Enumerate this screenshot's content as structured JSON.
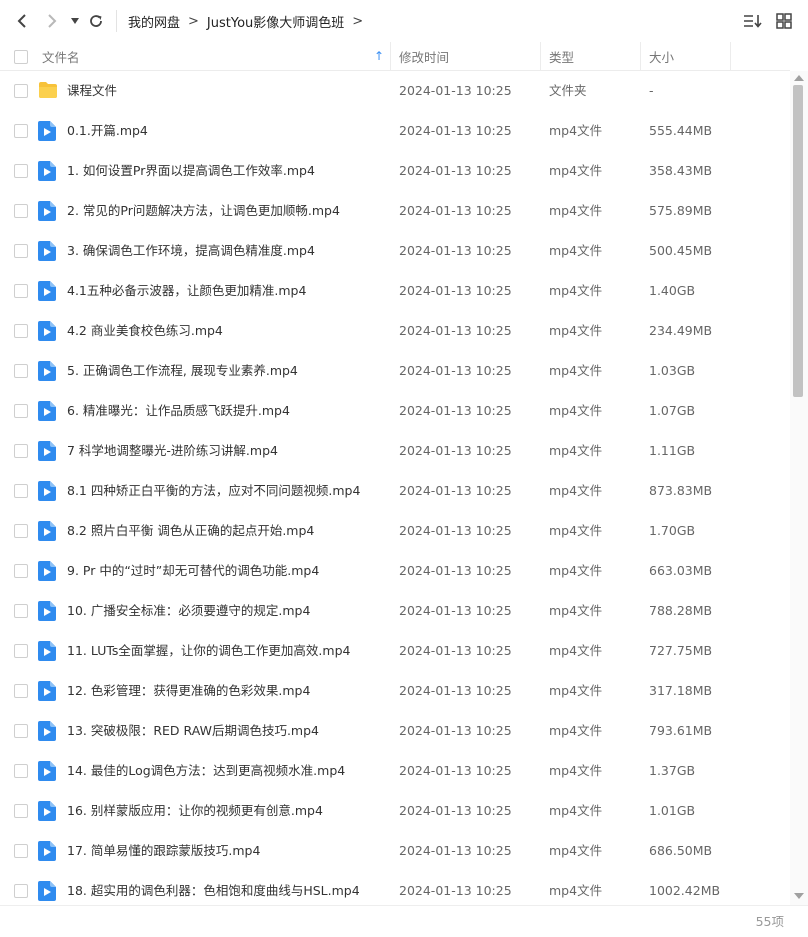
{
  "breadcrumb": [
    "我的网盘",
    "JustYou影像大师调色班"
  ],
  "columns": {
    "name": "文件名",
    "time": "修改时间",
    "type": "类型",
    "size": "大小"
  },
  "colors": {
    "accent": "#3b8ff3",
    "folder": "#f7c23a",
    "video": "#2f8bef"
  },
  "rows": [
    {
      "icon": "folder-icon",
      "name": "课程文件",
      "time": "2024-01-13 10:25",
      "type": "文件夹",
      "size": "-"
    },
    {
      "icon": "video-file-icon",
      "name": "0.1.开篇.mp4",
      "time": "2024-01-13 10:25",
      "type": "mp4文件",
      "size": "555.44MB"
    },
    {
      "icon": "video-file-icon",
      "name": "1. 如何设置Pr界面以提高调色工作效率.mp4",
      "time": "2024-01-13 10:25",
      "type": "mp4文件",
      "size": "358.43MB"
    },
    {
      "icon": "video-file-icon",
      "name": "2. 常见的Pr问题解决方法，让调色更加顺畅.mp4",
      "time": "2024-01-13 10:25",
      "type": "mp4文件",
      "size": "575.89MB"
    },
    {
      "icon": "video-file-icon",
      "name": "3. 确保调色工作环境，提高调色精准度.mp4",
      "time": "2024-01-13 10:25",
      "type": "mp4文件",
      "size": "500.45MB"
    },
    {
      "icon": "video-file-icon",
      "name": "4.1五种必备示波器，让颜色更加精准.mp4",
      "time": "2024-01-13 10:25",
      "type": "mp4文件",
      "size": "1.40GB"
    },
    {
      "icon": "video-file-icon",
      "name": "4.2 商业美食校色练习.mp4",
      "time": "2024-01-13 10:25",
      "type": "mp4文件",
      "size": "234.49MB"
    },
    {
      "icon": "video-file-icon",
      "name": "5. 正确调色工作流程, 展现专业素养.mp4",
      "time": "2024-01-13 10:25",
      "type": "mp4文件",
      "size": "1.03GB"
    },
    {
      "icon": "video-file-icon",
      "name": "6. 精准曝光：让作品质感飞跃提升.mp4",
      "time": "2024-01-13 10:25",
      "type": "mp4文件",
      "size": "1.07GB"
    },
    {
      "icon": "video-file-icon",
      "name": "7 科学地调整曝光-进阶练习讲解.mp4",
      "time": "2024-01-13 10:25",
      "type": "mp4文件",
      "size": "1.11GB"
    },
    {
      "icon": "video-file-icon",
      "name": "8.1 四种矫正白平衡的方法，应对不同问题视频.mp4",
      "time": "2024-01-13 10:25",
      "type": "mp4文件",
      "size": "873.83MB"
    },
    {
      "icon": "video-file-icon",
      "name": "8.2 照片白平衡 调色从正确的起点开始.mp4",
      "time": "2024-01-13 10:25",
      "type": "mp4文件",
      "size": "1.70GB"
    },
    {
      "icon": "video-file-icon",
      "name": "9. Pr 中的“过时”却无可替代的调色功能.mp4",
      "time": "2024-01-13 10:25",
      "type": "mp4文件",
      "size": "663.03MB"
    },
    {
      "icon": "video-file-icon",
      "name": "10. 广播安全标准：必须要遵守的规定.mp4",
      "time": "2024-01-13 10:25",
      "type": "mp4文件",
      "size": "788.28MB"
    },
    {
      "icon": "video-file-icon",
      "name": "11. LUTs全面掌握，让你的调色工作更加高效.mp4",
      "time": "2024-01-13 10:25",
      "type": "mp4文件",
      "size": "727.75MB"
    },
    {
      "icon": "video-file-icon",
      "name": "12. 色彩管理：获得更准确的色彩效果.mp4",
      "time": "2024-01-13 10:25",
      "type": "mp4文件",
      "size": "317.18MB"
    },
    {
      "icon": "video-file-icon",
      "name": "13. 突破极限：RED RAW后期调色技巧.mp4",
      "time": "2024-01-13 10:25",
      "type": "mp4文件",
      "size": "793.61MB"
    },
    {
      "icon": "video-file-icon",
      "name": "14. 最佳的Log调色方法：达到更高视频水准.mp4",
      "time": "2024-01-13 10:25",
      "type": "mp4文件",
      "size": "1.37GB"
    },
    {
      "icon": "video-file-icon",
      "name": "16. 别样蒙版应用：让你的视频更有创意.mp4",
      "time": "2024-01-13 10:25",
      "type": "mp4文件",
      "size": "1.01GB"
    },
    {
      "icon": "video-file-icon",
      "name": "17. 简单易懂的跟踪蒙版技巧.mp4",
      "time": "2024-01-13 10:25",
      "type": "mp4文件",
      "size": "686.50MB"
    },
    {
      "icon": "video-file-icon",
      "name": "18. 超实用的调色利器：色相饱和度曲线与HSL.mp4",
      "time": "2024-01-13 10:25",
      "type": "mp4文件",
      "size": "1002.42MB"
    }
  ],
  "footer": {
    "count": "55项"
  }
}
